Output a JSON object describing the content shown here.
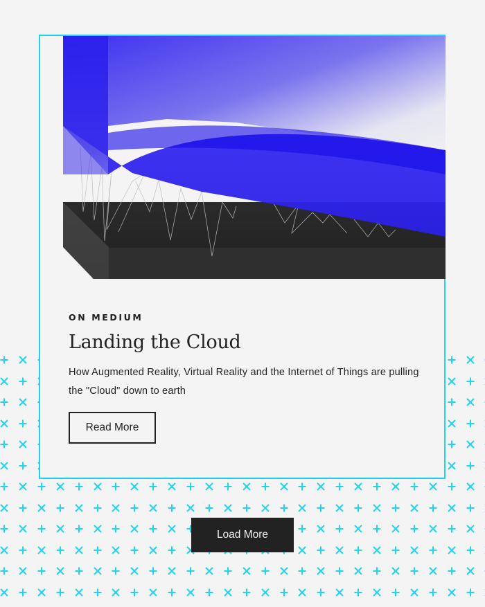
{
  "colors": {
    "background": "#f4f4f4",
    "accent_cyan": "#22d3ee",
    "dark": "#222222",
    "hero_blue": "#2a1df0"
  },
  "pattern": {
    "symbols": [
      "plus-icon",
      "cross-icon"
    ]
  },
  "card": {
    "hero_image_alt": "Abstract illustration of a blue cloud slab suspended by thin lines above a dark block",
    "kicker": "ON MEDIUM",
    "title": "Landing the Cloud",
    "description": "How Augmented Reality, Virtual Reality and the Internet of Things are pulling the \"Cloud\" down to earth",
    "read_more_label": "Read More"
  },
  "load_more_label": "Load More"
}
